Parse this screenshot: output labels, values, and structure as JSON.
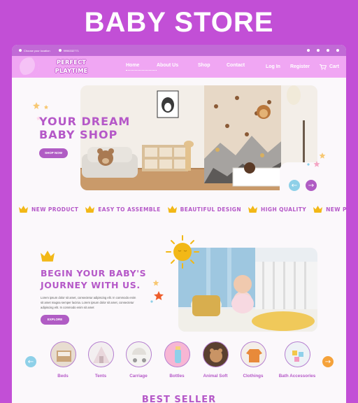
{
  "page_title": "BABY STORE",
  "topbar": {
    "location": "Choose your location",
    "phone": "9998332771",
    "social_icons": [
      "facebook-icon",
      "twitter-icon",
      "instagram-icon",
      "youtube-icon"
    ]
  },
  "nav": {
    "logo_line1": "PERFECT",
    "logo_line2": "PLAYTIME",
    "links": [
      "Home",
      "About Us",
      "Shop",
      "Contact"
    ],
    "login": "Log In",
    "register": "Register",
    "cart": "Cart"
  },
  "hero": {
    "title_line1": "YOUR DREAM",
    "title_line2": "BABY SHOP",
    "cta": "SHOP NOW"
  },
  "ticker": [
    "NEW PRODUCT",
    "EASY TO ASSEMBLE",
    "BEAUTIFUL DESIGN",
    "HIGH QUALITY",
    "NEW P"
  ],
  "section2": {
    "title_line1": "BEGIN YOUR BABY'S",
    "title_line2": "JOURNEY WITH US.",
    "text_line1": "Lorem ipsum dolor sit amet, consectetur adipiscing elit. In commodo enim",
    "text_line2": "sit amet magna semper lacinia. Lorem ipsum dolor sit amet, consectetur",
    "text_line3": "adipiscing elit. In commodo enim sit amet",
    "cta": "EXPLORE"
  },
  "categories": [
    "Beds",
    "Tents",
    "Carriage",
    "Bottles",
    "Animal Soft",
    "Clothings",
    "Bath Accessories"
  ],
  "best_seller": "BEST SELLER",
  "colors": {
    "brand_purple": "#c24fd6",
    "nav_pink": "#f0a6f3",
    "accent_text": "#b558c8",
    "crown_yellow": "#f2b817",
    "arrow_blue": "#8ed0e8",
    "arrow_orange": "#f5a23a"
  }
}
